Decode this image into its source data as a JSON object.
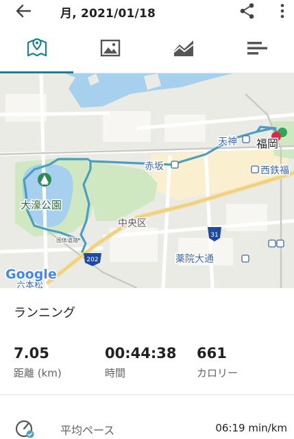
{
  "header": {
    "back_icon": "arrow-back-icon",
    "title": "月, 2021/01/18",
    "share_icon": "share-icon",
    "more_icon": "more-vert-icon"
  },
  "tabs": [
    {
      "name": "map",
      "icon": "map-icon",
      "active": true
    },
    {
      "name": "photos",
      "icon": "image-icon",
      "active": false
    },
    {
      "name": "chart",
      "icon": "area-chart-icon",
      "active": false
    },
    {
      "name": "details",
      "icon": "bar-list-icon",
      "active": false
    }
  ],
  "colors": {
    "accent": "#1a7f8e",
    "route": "#4a9ec0",
    "park": "#cfe8c2",
    "water": "#a6d0ee",
    "highway": "#f4d98c"
  },
  "map": {
    "labels": {
      "park": "大濠公園",
      "ward": "中央区",
      "akasaka": "赤坂",
      "tenjin": "天神",
      "fukuoka": "福岡",
      "nishitetsu": "西鉄福",
      "yakuin": "薬院大通",
      "road_label": "国体道路",
      "route_31": "31",
      "route_202": "202",
      "logo": "Google",
      "cut_label": "六本松"
    }
  },
  "activity": {
    "type": "ランニング",
    "stats": [
      {
        "value": "7.05",
        "label": "距離 (km)"
      },
      {
        "value": "00:44:38",
        "label": "時間"
      },
      {
        "value": "661",
        "label": "カロリー"
      }
    ],
    "pace": {
      "icon": "pace-gauge-icon",
      "label": "平均ペース",
      "value": "06:19 min/km"
    }
  }
}
